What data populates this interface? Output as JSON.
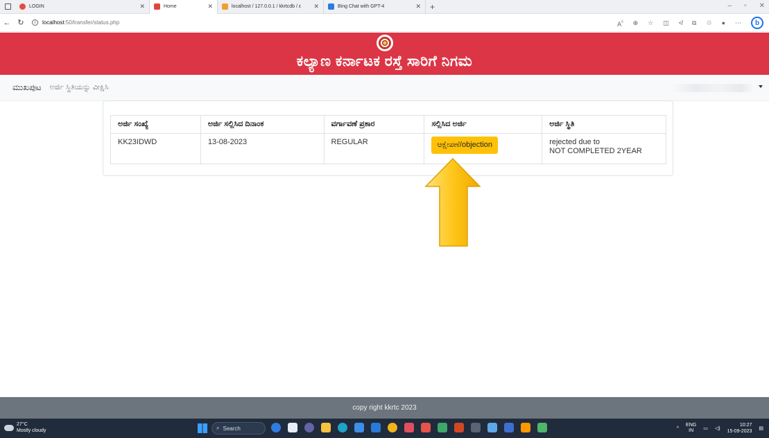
{
  "browser": {
    "tabs": [
      {
        "label": "LOGIN",
        "favicon_color": "#e74c3c"
      },
      {
        "label": "Home",
        "favicon_color": "#e0463c"
      },
      {
        "label": "localhost / 127.0.0.1 / kkrtcdb / ε",
        "favicon_color": "#f0a030"
      },
      {
        "label": "Bing Chat with GPT-4",
        "favicon_color": "#2d7be0"
      }
    ],
    "url_host": "localhost",
    "url_path": ":50/transfer/status.php",
    "tool_text": "A",
    "tool_icons": [
      "read-aloud",
      "zoom",
      "favorite",
      "split",
      "favorites",
      "collections",
      "extensions",
      "profile",
      "more"
    ]
  },
  "site": {
    "title": "ಕಲ್ಯಾಣ ಕರ್ನಾಟಕ ರಸ್ತೆ ಸಾರಿಗೆ ನಿಗಮ",
    "header_color": "#dc3545"
  },
  "nav": {
    "home": "ಮುಖಪುಟ",
    "status_link": "ಅರ್ಜಿ ಸ್ಥಿತಿಯನ್ನು ವೀಕ್ಷಿಸಿ"
  },
  "table": {
    "headers": [
      "ಅರ್ಜಿ ಸಂಖ್ಯೆ",
      "ಅರ್ಜಿ ಸಲ್ಲಿಸಿದ ದಿನಾಂಕ",
      "ವರ್ಗಾವಣೆ ಪ್ರಕಾರ",
      "ಸಲ್ಲಿಸಿದ ಅರ್ಜಿ",
      "ಅರ್ಜಿ ಸ್ಥಿತಿ"
    ],
    "row": {
      "app_no": "KK23IDWD",
      "date": "13-08-2023",
      "type": "REGULAR",
      "button": "ಆಕ್ಷೇಪಣೆ/objection",
      "status_line1": "rejected due to",
      "status_line2": "NOT COMPLETED 2YEAR"
    }
  },
  "footer": {
    "text": "copy right kkrtc 2023"
  },
  "taskbar": {
    "temp": "27°C",
    "weather": "Mostly cloudy",
    "search": "Search",
    "lang1": "ENG",
    "lang2": "IN",
    "time": "10:27",
    "date": "15-09-2023"
  }
}
